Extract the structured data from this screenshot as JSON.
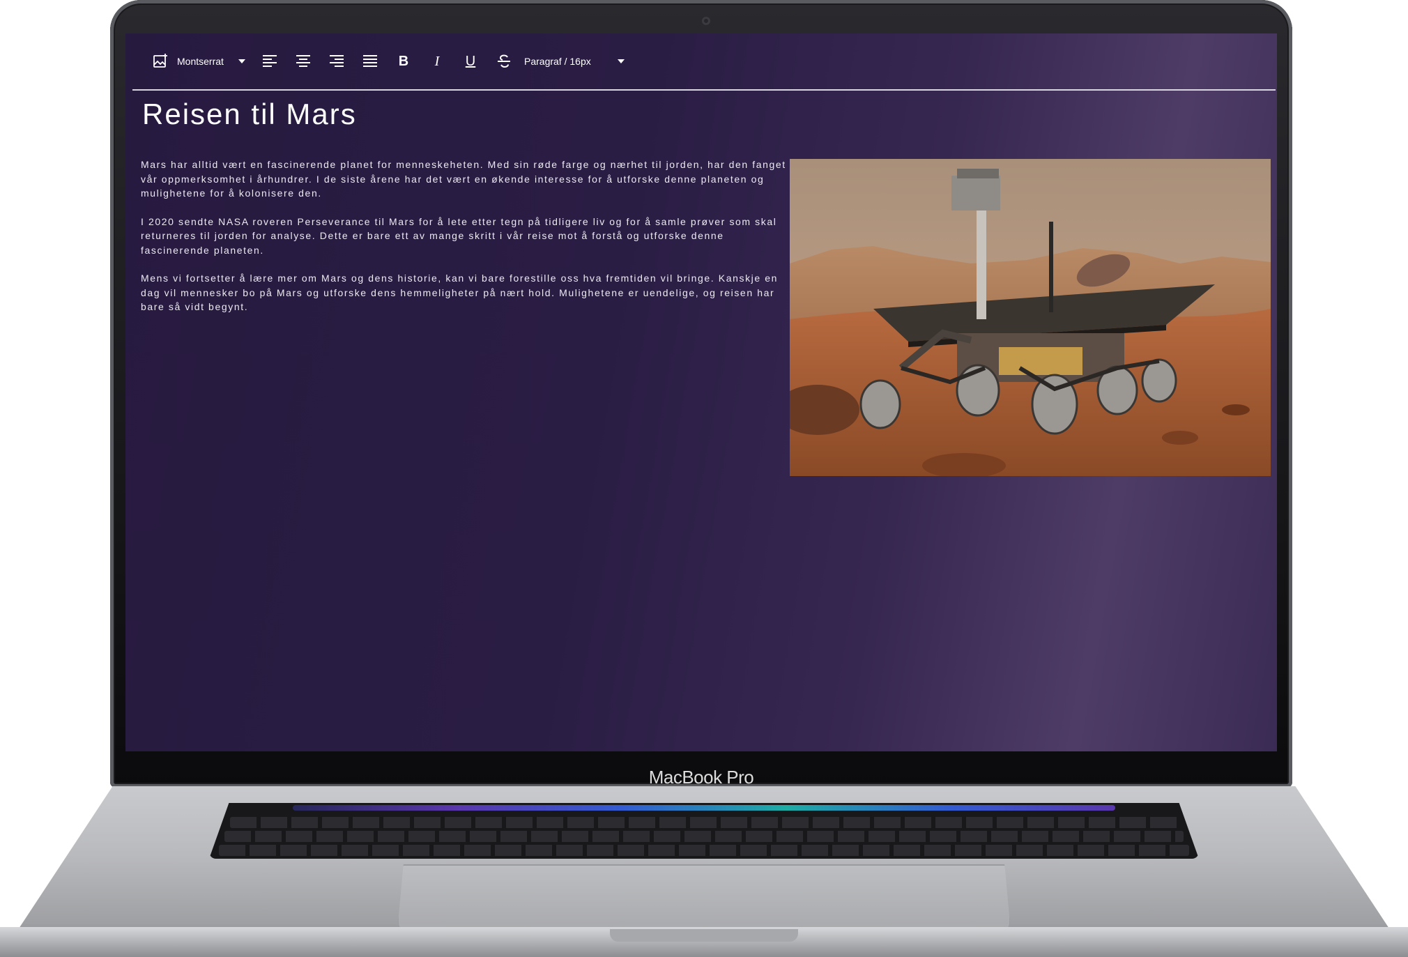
{
  "device": {
    "brand_label": "MacBook Pro"
  },
  "toolbar": {
    "font_family": "Montserrat",
    "paragraph_style": "Paragraf / 16px",
    "bold_label": "B",
    "italic_label": "I",
    "underline_label": "U"
  },
  "document": {
    "title": "Reisen til Mars",
    "paragraphs": [
      "Mars har alltid vært en fascinerende planet for menneskeheten. Med sin røde farge og nærhet til jorden, har den fanget vår oppmerksomhet i århundrer. I de siste årene har det vært en økende interesse for å utforske denne planeten og mulighetene for å kolonisere den.",
      "I 2020 sendte NASA roveren Perseverance til Mars for å lete etter tegn på tidligere liv og for å samle prøver som skal returneres til jorden for analyse. Dette er bare ett av mange skritt i vår reise mot å forstå og utforske denne fascinerende planeten.",
      "Mens vi fortsetter å lære mer om Mars og dens historie, kan vi bare forestille oss hva fremtiden vil bringe. Kanskje en dag vil mennesker bo på Mars og utforske dens hemmeligheter på nært hold. Mulighetene er uendelige, og reisen har bare så vidt begynt."
    ]
  },
  "colors": {
    "screen_bg": "#271a3f",
    "text": "#ffffff"
  }
}
